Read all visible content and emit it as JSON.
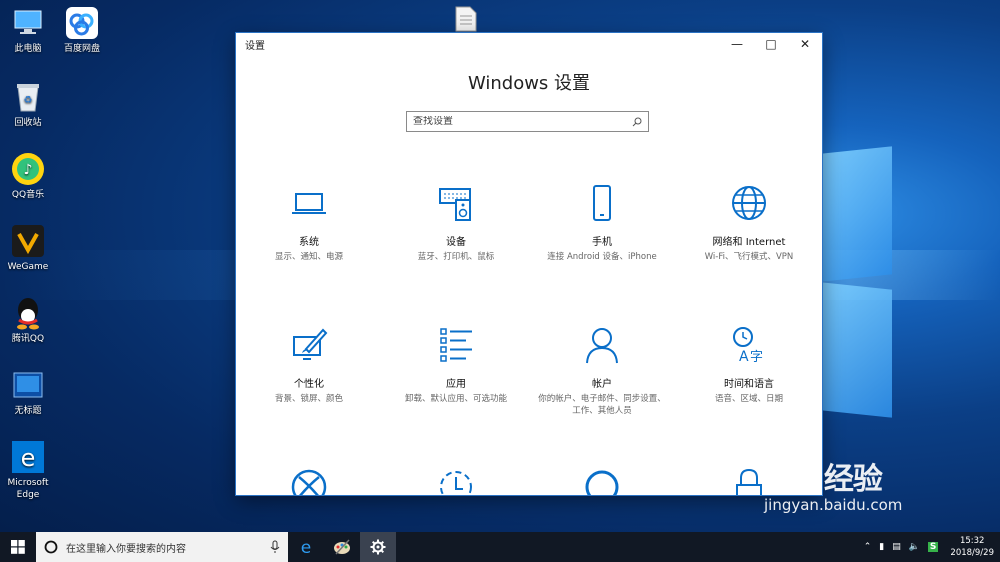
{
  "desktop": {
    "icons": [
      {
        "label": "此电脑",
        "icon": "computer-icon"
      },
      {
        "label": "百度网盘",
        "icon": "baidu-netdisk-icon"
      },
      {
        "label": "回收站",
        "icon": "recycle-bin-icon"
      },
      {
        "label": "QQ音乐",
        "icon": "qq-music-icon"
      },
      {
        "label": "WeGame",
        "icon": "wegame-icon"
      },
      {
        "label": "腾讯QQ",
        "icon": "qq-icon"
      },
      {
        "label": "无标题",
        "icon": "untitled-file-icon"
      },
      {
        "label": "Microsoft Edge",
        "icon": "edge-icon"
      }
    ]
  },
  "window": {
    "title": "设置",
    "heading": "Windows 设置",
    "search_placeholder": "查找设置",
    "categories": [
      {
        "title": "系统",
        "desc": "显示、通知、电源",
        "icon": "laptop-icon"
      },
      {
        "title": "设备",
        "desc": "蓝牙、打印机、鼠标",
        "icon": "devices-icon"
      },
      {
        "title": "手机",
        "desc": "连接 Android 设备、iPhone",
        "icon": "phone-icon"
      },
      {
        "title": "网络和 Internet",
        "desc": "Wi-Fi、飞行模式、VPN",
        "icon": "globe-icon"
      },
      {
        "title": "个性化",
        "desc": "背景、锁屏、颜色",
        "icon": "personalization-icon"
      },
      {
        "title": "应用",
        "desc": "卸载、默认应用、可选功能",
        "icon": "apps-list-icon"
      },
      {
        "title": "帐户",
        "desc": "你的帐户、电子邮件、同步设置、工作、其他人员",
        "icon": "person-icon"
      },
      {
        "title": "时间和语言",
        "desc": "语音、区域、日期",
        "icon": "time-language-icon"
      },
      {
        "title": "",
        "desc": "",
        "icon": "xbox-icon"
      },
      {
        "title": "",
        "desc": "",
        "icon": "ease-of-access-icon"
      },
      {
        "title": "",
        "desc": "",
        "icon": "cortana-icon"
      },
      {
        "title": "",
        "desc": "",
        "icon": "lock-icon"
      }
    ]
  },
  "taskbar": {
    "search_text": "在这里输入你要搜索的内容",
    "time": "15:32",
    "date": "2018/9/29"
  },
  "watermark": {
    "brand": "Bai 经验",
    "url": "jingyan.baidu.com"
  },
  "colors": {
    "accent": "#0a6fc9",
    "taskbar": "#111824"
  }
}
